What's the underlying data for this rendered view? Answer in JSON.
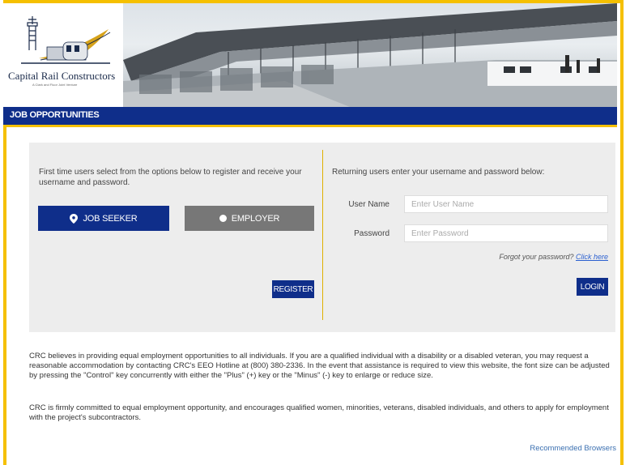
{
  "logo": {
    "name": "Capital Rail Constructors",
    "tagline": "A Clark and Fluor Joint Venture"
  },
  "nav": {
    "title": "JOB OPPORTUNITIES"
  },
  "register_panel": {
    "intro": "First time users select from the options below to register and receive your username and password.",
    "job_seeker_label": "JOB SEEKER",
    "employer_label": "EMPLOYER",
    "register_label": "REGISTER"
  },
  "login_panel": {
    "intro": "Returning users enter your username and password below:",
    "username_label": "User Name",
    "username_placeholder": "Enter User Name",
    "password_label": "Password",
    "password_placeholder": "Enter Password",
    "forgot_text": "Forgot your password?",
    "forgot_link": "Click here",
    "login_label": "LOGIN"
  },
  "paragraphs": [
    "CRC believes in providing equal employment opportunities to all individuals. If you are a qualified individual with a disability or a disabled veteran, you may request a reasonable accommodation by contacting CRC's EEO Hotline at (800) 380-2336. In the event that assistance is required to view this website, the font size can be adjusted by pressing the \"Control\" key concurrently with either the \"Plus\" (+) key or the \"Minus\" (-) key to enlarge or reduce size.",
    "CRC is firmly committed to equal employment opportunity, and encourages qualified women, minorities, veterans, disabled individuals, and others to apply for employment with the project's subcontractors."
  ],
  "footer": {
    "recommended_browsers": "Recommended Browsers"
  },
  "colors": {
    "brand_blue": "#0f2e8a",
    "accent_gold": "#f5c000",
    "employer_gray": "#777777"
  }
}
